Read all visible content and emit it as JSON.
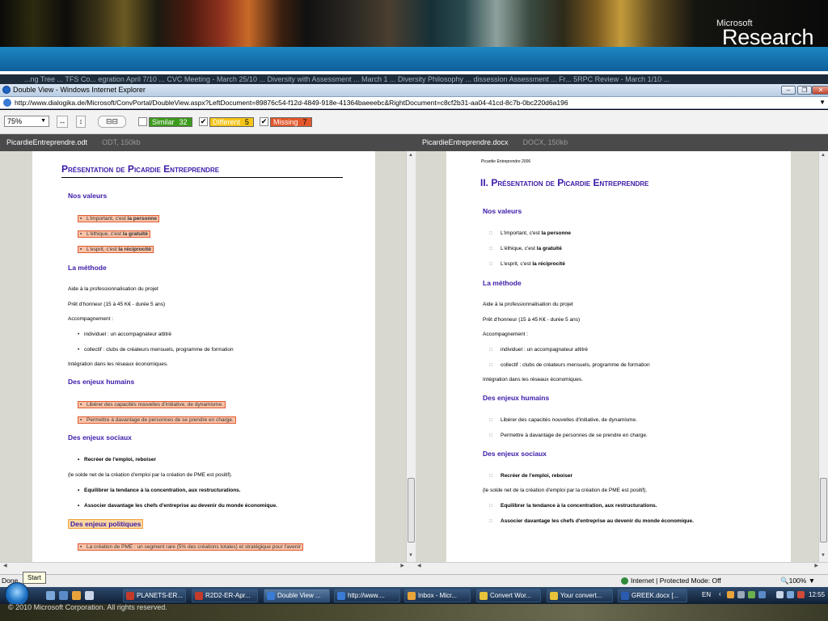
{
  "slide": {
    "brand_small": "Microsoft",
    "brand_big": "Research",
    "copyright": "© 2010 Microsoft Corporation. All rights reserved."
  },
  "background_strip": "  ...ng Tree  ...   TFS Co...   egration  April 7/10 ...   CVC Meeting - March 25/10 ...   Diversity with Assessment ...   March 1 ...   Diversity Philosophy ...   dissession   Assessment ...   Fr...   5RPC Review - March 1/10 ...",
  "window": {
    "title": "Double View - Windows Internet Explorer",
    "address": "http://www.dialogika.de/Microsoft/ConvPortal/DoubleView.aspx?LeftDocument=89876c54-f12d-4849-918e-41364baeeebc&RightDocument=c8cf2b31-aa04-41cd-8c7b-0bc220d6a196"
  },
  "toolbar": {
    "zoom": "75%",
    "filters": [
      {
        "label": "Similar",
        "count": "32",
        "checked": false,
        "color": "#3c9b1d"
      },
      {
        "label": "Different",
        "count": "5",
        "checked": true,
        "color": "#f5c518"
      },
      {
        "label": "Missing",
        "count": "7",
        "checked": true,
        "color": "#e2572b"
      }
    ]
  },
  "left_doc": {
    "filename": "PicardieEntreprendre.odt",
    "meta": "ODT, 150kb",
    "title": "Présentation de Picardie Entreprendre",
    "h_valeurs": "Nos valeurs",
    "v1_pre": "L'important, c'est ",
    "v1_b": "la personne",
    "v2_pre": "L'éthique, c'est ",
    "v2_b": "la gratuité",
    "v3_pre": "L'esprit, c'est ",
    "v3_b": "la réciprocité",
    "h_methode": "La méthode",
    "m1": "Aide à la professionnalisation du projet",
    "m2": "Prêt d'honneur (15 à 45 K€ - durée 5 ans)",
    "m3": "Accompagnement :",
    "m4": "individuel : un accompagnateur attitré",
    "m5": "collectif : clubs de créateurs mensuels, programme de formation",
    "m6": "Intégration dans les réseaux économiques.",
    "h_humains": "Des enjeux humains",
    "hu1": "Libérer des capacités nouvelles d'initiative, de dynamisme.",
    "hu2": "Permettre à davantage de personnes de se prendre en charge.",
    "h_sociaux": "Des enjeux sociaux",
    "s1": "Recréer de l'emploi, reboiser",
    "s2": "(le solde net de la création d'emploi par la création de PME est positif).",
    "s3": "Equilibrer la tendance à la concentration, aux restructurations.",
    "s4": "Associer davantage les chefs d'entreprise au devenir du monde économique.",
    "h_politiques": "Des enjeux politiques",
    "p1": "La création de PME : un segment rare (5% des créations totales) et stratégique pour l'avenir"
  },
  "right_doc": {
    "filename": "PicardieEntreprendre.docx",
    "meta": "DOCX, 150kb",
    "header": "Picardie Entreprendre 2006",
    "title": "II.   Présentation de Picardie Entreprendre",
    "h_valeurs": "Nos valeurs",
    "v1_pre": "L'important, c'est ",
    "v1_b": "la personne",
    "v2_pre": "L'éthique, c'est ",
    "v2_b": "la gratuité",
    "v3_pre": "L'esprit, c'est ",
    "v3_b": "la réciprocité",
    "h_methode": "La méthode",
    "m1": "Aide à la professionnalisation du projet",
    "m2": "Prêt d'honneur (15 à 45 K€ - durée 5 ans)",
    "m3": "Accompagnement :",
    "m4": "individuel : un accompagnateur attitré",
    "m5": "collectif : clubs de créateurs mensuels, programme de formation",
    "m6": "Intégration dans les réseaux économiques.",
    "h_humains": "Des enjeux humains",
    "hu1": "Libérer des capacités nouvelles d'initiative, de dynamisme.",
    "hu2": "Permettre à davantage de personnes de se prendre en charge.",
    "h_sociaux": "Des enjeux sociaux",
    "s1": "Recréer de l'emploi, reboiser",
    "s2": "(le solde net de la création d'emploi par la création de PME est positif).",
    "s3": "Equilibrer la tendance à la concentration, aux restructurations.",
    "s4": "Associer davantage les chefs d'entreprise au devenir du monde économique."
  },
  "status": {
    "left": "Done",
    "tooltip": "Start",
    "zone": "Internet | Protected Mode: Off",
    "zoom": "100%"
  },
  "taskbar": {
    "tasks": [
      "PLANETS-ER...",
      "R2D2-ER-Apr...",
      "Double View ...",
      "http://www....",
      "Inbox - Micr...",
      "Convert Wor...",
      "Your convert...",
      "GREEK.docx [..."
    ],
    "lang": "EN",
    "clock": "12:55"
  }
}
